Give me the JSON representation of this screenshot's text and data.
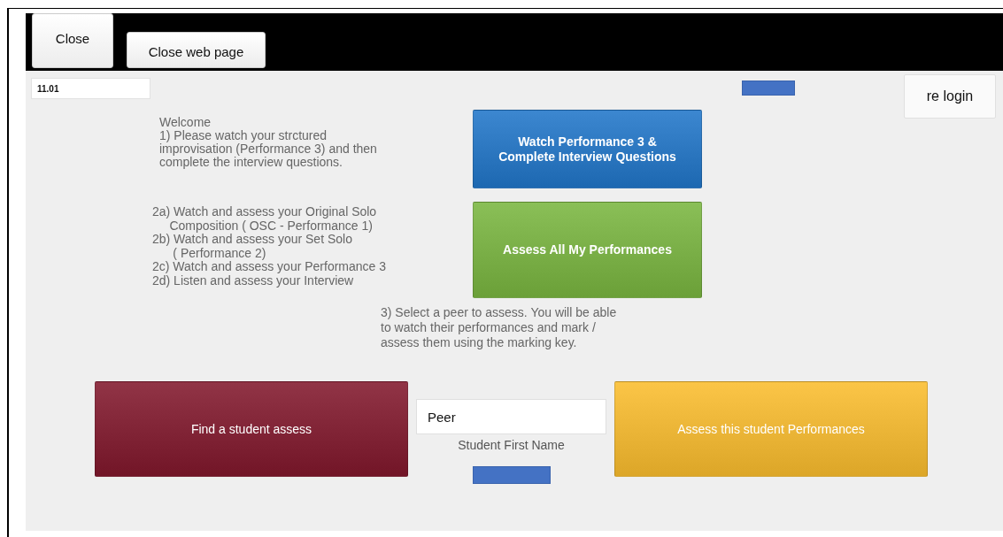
{
  "top_bar": {
    "buttons": [
      {
        "label": "Close",
        "kind": "tall"
      },
      {
        "label": "Close web page",
        "kind": "short"
      }
    ]
  },
  "time_field": {
    "value": "11.01"
  },
  "relogin_button": {
    "label": "re login"
  },
  "steps": [
    {
      "texts": [
        "Welcome\n1) Please watch your strctured\nimprovisation (Performance 3) and then\ncomplete the interview questions."
      ],
      "button": {
        "label": "Watch Performance 3 &\nComplete Interview Questions",
        "color": "#2176c9"
      }
    },
    {
      "texts": [
        "2a) Watch and assess your Original Solo\n     Composition ( OSC - Performance 1)\n2b) Watch and assess your Set Solo\n      ( Performance 2)\n2c) Watch and assess your Performance 3\n2d) Listen and assess your Interview"
      ],
      "button": {
        "label": "Assess All My Performances",
        "color": "#7ab640"
      }
    }
  ],
  "peer_step": {
    "text": "3) Select a peer to assess. You will be able\nto watch their performances and mark /\nassess them using the marking key."
  },
  "find_button": {
    "label": "Find a student assess",
    "color": "#82182c"
  },
  "peer_field": {
    "value": "Peer",
    "label": "Student First Name"
  },
  "assess_button": {
    "label": "Assess this student Performances",
    "color": "#fbbd2e"
  }
}
